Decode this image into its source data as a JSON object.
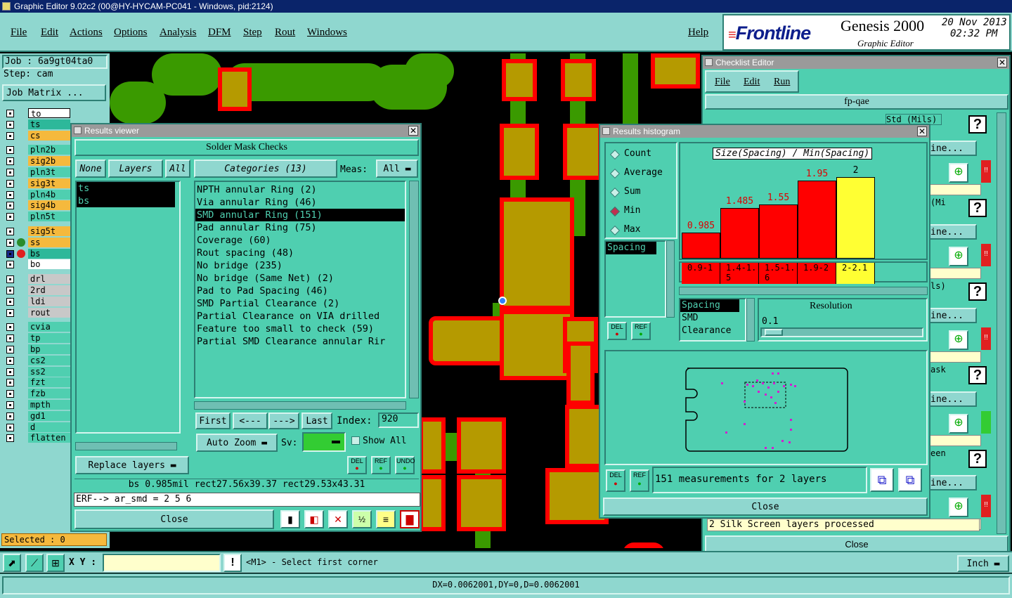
{
  "window_title": "Graphic Editor 9.02c2 (00@HY-HYCAM-PC041 - Windows, pid:2124)",
  "menu": {
    "file": "File",
    "edit": "Edit",
    "actions": "Actions",
    "options": "Options",
    "analysis": "Analysis",
    "dfm": "DFM",
    "step": "Step",
    "rout": "Rout",
    "windows": "Windows",
    "help": "Help"
  },
  "brand": {
    "logo": "Frontline",
    "product": "Genesis 2000",
    "subtitle": "Graphic Editor",
    "date": "20 Nov 2013",
    "time": "02:32 PM"
  },
  "job": {
    "job_label": "Job : 6a9gt04ta0",
    "step_label": "Step: cam",
    "matrix_button": "Job Matrix ..."
  },
  "layers": [
    {
      "name": "to",
      "color": "#ffffff"
    },
    {
      "name": "ts",
      "color": "#2db89a"
    },
    {
      "name": "cs",
      "color": "#f5b93d"
    },
    {
      "name": "pln2b",
      "color": "#4fcfb0"
    },
    {
      "name": "sig2b",
      "color": "#f5b93d"
    },
    {
      "name": "pln3t",
      "color": "#4fcfb0"
    },
    {
      "name": "sig3t",
      "color": "#f5b93d"
    },
    {
      "name": "pln4b",
      "color": "#4fcfb0"
    },
    {
      "name": "sig4b",
      "color": "#f5b93d"
    },
    {
      "name": "pln5t",
      "color": "#4fcfb0"
    },
    {
      "name": "sig5t",
      "color": "#f5b93d"
    },
    {
      "name": "ss",
      "color": "#f5b93d"
    },
    {
      "name": "bs",
      "color": "#2db89a"
    },
    {
      "name": "bo",
      "color": "#ffffff"
    },
    {
      "name": "drl",
      "color": "#c8c8c8"
    },
    {
      "name": "2rd",
      "color": "#c8c8c8"
    },
    {
      "name": "ldi",
      "color": "#c8c8c8"
    },
    {
      "name": "rout",
      "color": "#c8c8c8"
    },
    {
      "name": "cvia",
      "color": "#4fcfb0"
    },
    {
      "name": "tp",
      "color": "#4fcfb0"
    },
    {
      "name": "bp",
      "color": "#4fcfb0"
    },
    {
      "name": "cs2",
      "color": "#4fcfb0"
    },
    {
      "name": "ss2",
      "color": "#4fcfb0"
    },
    {
      "name": "fzt",
      "color": "#4fcfb0"
    },
    {
      "name": "fzb",
      "color": "#4fcfb0"
    },
    {
      "name": "mpth",
      "color": "#4fcfb0"
    },
    {
      "name": "gd1",
      "color": "#4fcfb0"
    },
    {
      "name": "d",
      "color": "#4fcfb0"
    },
    {
      "name": "flatten",
      "color": "#4fcfb0"
    }
  ],
  "selected_label": "Selected : 0",
  "results_viewer": {
    "title": "Results viewer",
    "header": "Solder Mask Checks",
    "none_btn": "None",
    "layers_btn": "Layers",
    "all_btn": "All",
    "layer_items": [
      "ts",
      "bs"
    ],
    "categories_btn": "Categories (13)",
    "meas_label": "Meas:",
    "meas_value": "All",
    "categories": [
      "NPTH annular Ring (2)",
      "Via annular Ring (46)",
      "SMD annular Ring (151)",
      "Pad annular Ring (75)",
      "Coverage (60)",
      "Rout spacing (48)",
      "No bridge (235)",
      "No bridge (Same Net) (2)",
      "Pad to Pad Spacing (46)",
      "SMD Partial Clearance (2)",
      "Partial Clearance on VIA drilled",
      "Feature too small to check (59)",
      "Partial SMD Clearance annular Rir"
    ],
    "first_btn": "First",
    "prev_btn": "<---",
    "next_btn": "--->",
    "last_btn": "Last",
    "index_label": "Index:",
    "index_value": "920",
    "autozoom_btn": "Auto Zoom",
    "sv_label": "Sv:",
    "show_all_label": "Show All",
    "replace_btn": "Replace layers",
    "status_line": "bs 0.985mil   rect27.56x39.37   rect29.53x43.31",
    "erf_line": "ERF--> ar_smd = 2 5 6",
    "close_btn": "Close",
    "del": "DEL",
    "ref": "REF",
    "undo": "UNDO"
  },
  "histogram": {
    "title": "Results histogram",
    "options": [
      "Count",
      "Average",
      "Sum",
      "Min",
      "Max"
    ],
    "selected_option": "Min",
    "measure_list": [
      "Spacing"
    ],
    "chart_title": "Size(Spacing) / Min(Spacing)",
    "ranges": [
      "0.9-1",
      "1.4-1.5",
      "1.5-1.6",
      "1.9-2",
      "2-2.1"
    ],
    "labels": [
      "0.985",
      "1.485",
      "1.55",
      "1.95",
      "2"
    ],
    "values": [
      0.985,
      1.485,
      1.55,
      1.95,
      2
    ],
    "sort_list": [
      "Spacing",
      "SMD",
      "Clearance"
    ],
    "resolution_label": "Resolution",
    "resolution_value": "0.1",
    "summary": "151 measurements for 2 layers",
    "close_btn": "Close"
  },
  "checklist": {
    "title": "Checklist Editor",
    "file": "File",
    "edit": "Edit",
    "run": "Run",
    "name": "fp-qae",
    "std_label": "Std (Mils)",
    "line_label": "ine...",
    "mi_label": "(Mi",
    "ls_label": "ls)",
    "ask_label": "ask",
    "een_label": "een",
    "status": "2 Silk Screen layers processed",
    "close_btn": "Close"
  },
  "bottom": {
    "xy_label": "X Y :",
    "prompt": "<M1> - Select first corner",
    "units": "Inch",
    "measure": "DX=0.0062001,DY=0,D=0.0062001"
  }
}
